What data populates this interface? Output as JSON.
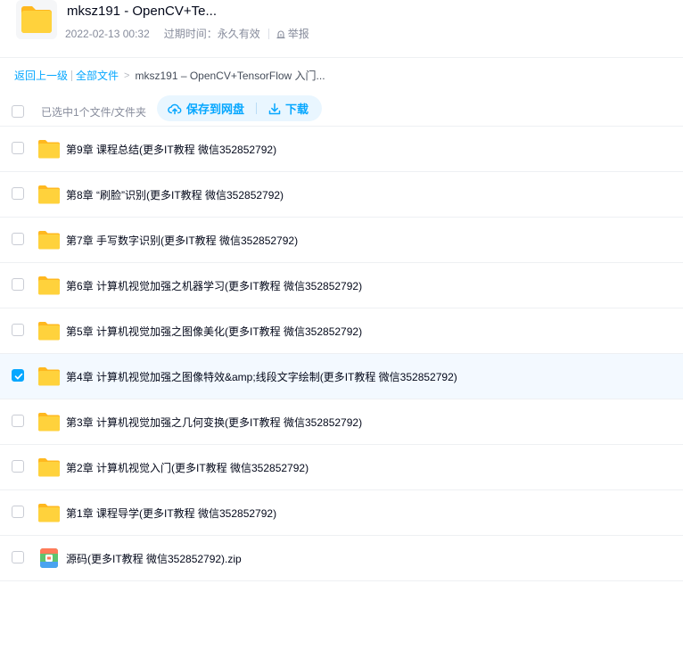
{
  "share": {
    "title": "mksz191 - OpenCV+Te...",
    "date": "2022-02-13 00:32",
    "expire_label": "过期时间：",
    "expire_value": "永久有效",
    "report_label": "举报"
  },
  "breadcrumb": {
    "back_label": "返回上一级",
    "all_files_label": "全部文件",
    "separator": ">",
    "current": "mksz191 – OpenCV+TensorFlow 入门..."
  },
  "toolbar": {
    "selection_text": "已选中1个文件/文件夹",
    "save_label": "保存到网盘",
    "download_label": "下载"
  },
  "colors": {
    "accent": "#06a7ff",
    "folder": "#ffc933",
    "selected_row_bg": "#f3f9ff"
  },
  "files": [
    {
      "name": "第9章 课程总结(更多IT教程 微信352852792)",
      "type": "folder",
      "checked": false
    },
    {
      "name": "第8章 “刷脸”识别(更多IT教程 微信352852792)",
      "type": "folder",
      "checked": false
    },
    {
      "name": "第7章 手写数字识别(更多IT教程 微信352852792)",
      "type": "folder",
      "checked": false
    },
    {
      "name": "第6章 计算机视觉加强之机器学习(更多IT教程 微信352852792)",
      "type": "folder",
      "checked": false
    },
    {
      "name": "第5章 计算机视觉加强之图像美化(更多IT教程 微信352852792)",
      "type": "folder",
      "checked": false
    },
    {
      "name": "第4章 计算机视觉加强之图像特效&amp;线段文字绘制(更多IT教程 微信352852792)",
      "type": "folder",
      "checked": true
    },
    {
      "name": "第3章 计算机视觉加强之几何变换(更多IT教程 微信352852792)",
      "type": "folder",
      "checked": false
    },
    {
      "name": "第2章 计算机视觉入门(更多IT教程 微信352852792)",
      "type": "folder",
      "checked": false
    },
    {
      "name": "第1章 课程导学(更多IT教程 微信352852792)",
      "type": "folder",
      "checked": false
    },
    {
      "name": "源码(更多IT教程 微信352852792).zip",
      "type": "zip",
      "checked": false
    }
  ]
}
